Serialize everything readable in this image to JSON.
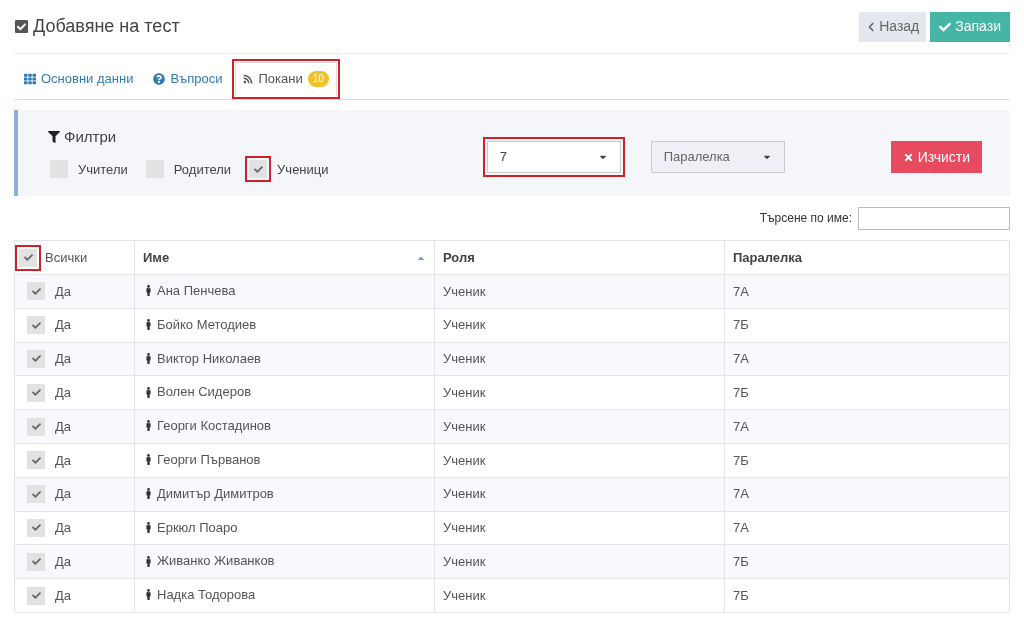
{
  "page": {
    "title": "Добавяне на тест"
  },
  "buttons": [
    {
      "kind": "back",
      "label": "Назад"
    },
    {
      "kind": "save",
      "label": "Запази"
    }
  ],
  "tabs": [
    {
      "kind": "grid",
      "label": "Основни данни",
      "selected": false,
      "highlighted": false
    },
    {
      "kind": "question",
      "label": "Въпроси",
      "selected": false,
      "highlighted": false
    },
    {
      "kind": "rss",
      "label": "Покани",
      "badge": "10",
      "selected": true,
      "highlighted": true
    }
  ],
  "filters": {
    "title": "Филтри",
    "checkboxes": [
      {
        "label": "Учители",
        "checked": false,
        "highlighted": false
      },
      {
        "label": "Родители",
        "checked": false,
        "highlighted": false
      },
      {
        "label": "Ученици",
        "checked": true,
        "highlighted": true
      }
    ],
    "selects": [
      {
        "value": "7",
        "highlighted": true,
        "kind": "value"
      },
      {
        "value": "Паралелка",
        "highlighted": false,
        "kind": "placeholder"
      }
    ],
    "clear_button": "Изчисти"
  },
  "search": {
    "label": "Търсене по име:"
  },
  "table": {
    "select_all": {
      "label": "Всички",
      "checked": true,
      "highlighted": true
    },
    "columns": [
      {
        "label": "Име",
        "sorted": true
      },
      {
        "label": "Роля",
        "sorted": false
      },
      {
        "label": "Паралелка",
        "sorted": false
      }
    ],
    "rows": [
      {
        "checked": true,
        "selected_text": "Да",
        "name": "Ана Пенчева",
        "role": "Ученик",
        "class": "7А"
      },
      {
        "checked": true,
        "selected_text": "Да",
        "name": "Бойко Методиев",
        "role": "Ученик",
        "class": "7Б"
      },
      {
        "checked": true,
        "selected_text": "Да",
        "name": "Виктор Николаев",
        "role": "Ученик",
        "class": "7А"
      },
      {
        "checked": true,
        "selected_text": "Да",
        "name": "Волен Сидеров",
        "role": "Ученик",
        "class": "7Б"
      },
      {
        "checked": true,
        "selected_text": "Да",
        "name": "Георги Костадинов",
        "role": "Ученик",
        "class": "7А"
      },
      {
        "checked": true,
        "selected_text": "Да",
        "name": "Георги Първанов",
        "role": "Ученик",
        "class": "7Б"
      },
      {
        "checked": true,
        "selected_text": "Да",
        "name": "Димитър Димитров",
        "role": "Ученик",
        "class": "7А"
      },
      {
        "checked": true,
        "selected_text": "Да",
        "name": "Еркюл Поаро",
        "role": "Ученик",
        "class": "7А"
      },
      {
        "checked": true,
        "selected_text": "Да",
        "name": "Живанко Живанков",
        "role": "Ученик",
        "class": "7Б"
      },
      {
        "checked": true,
        "selected_text": "Да",
        "name": "Надка Тодорова",
        "role": "Ученик",
        "class": "7Б"
      }
    ]
  }
}
